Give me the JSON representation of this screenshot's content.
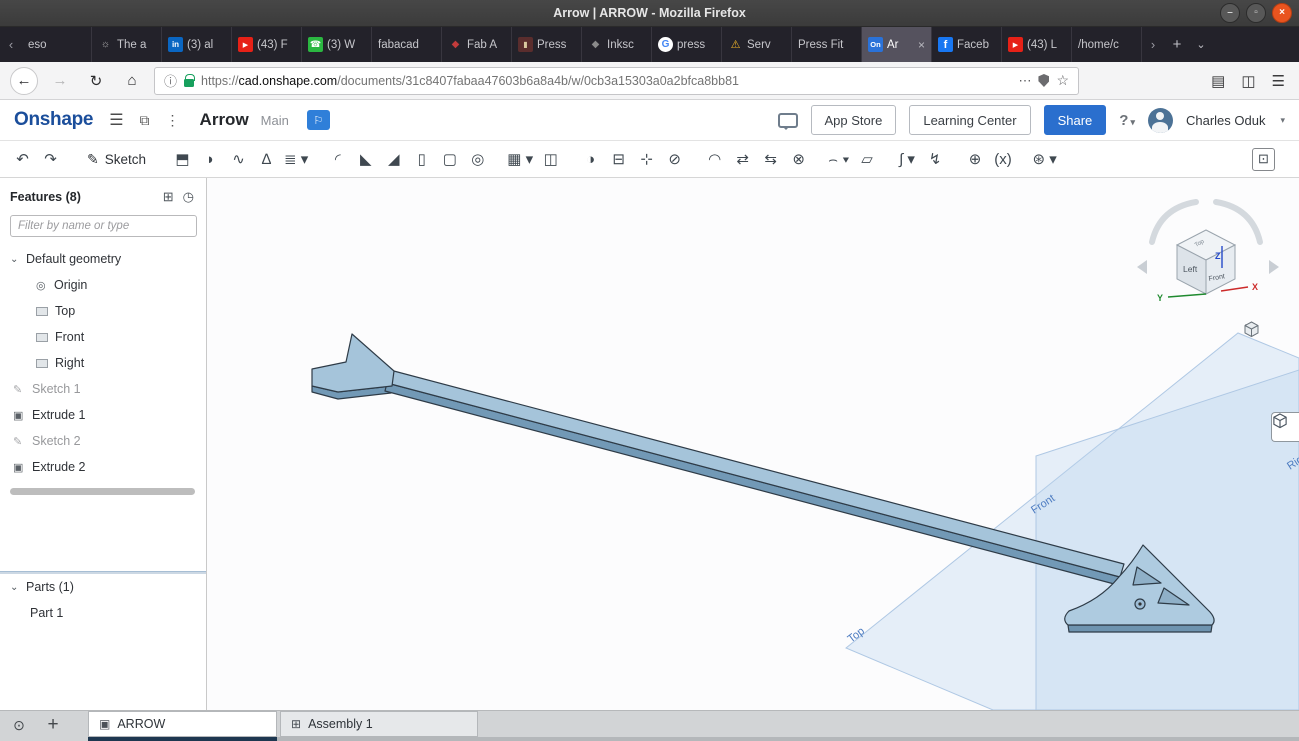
{
  "window": {
    "title": "Arrow | ARROW - Mozilla Firefox",
    "minimize": "–",
    "maximize": "▫",
    "close": "×"
  },
  "tabstrip": {
    "scroll_left": "‹",
    "scroll_right": "›",
    "new_tab": "+",
    "list_tabs": "⌄",
    "close_tab": "×",
    "tabs": [
      {
        "title": "eso",
        "fav": ""
      },
      {
        "title": "The a",
        "fav": "☼"
      },
      {
        "title": "(3) al",
        "fav": "in"
      },
      {
        "title": "(43) F",
        "fav": "▶"
      },
      {
        "title": "(3) W",
        "fav": "☎"
      },
      {
        "title": "fabacad",
        "fav": ""
      },
      {
        "title": "Fab A",
        "fav": "◆"
      },
      {
        "title": "Press",
        "fav": "▮"
      },
      {
        "title": "Inksc",
        "fav": "◆"
      },
      {
        "title": "press",
        "fav": "G"
      },
      {
        "title": "Serv",
        "fav": "⚠"
      },
      {
        "title": "Press Fit",
        "fav": ""
      },
      {
        "title": "Ar",
        "fav": "On"
      },
      {
        "title": "Faceb",
        "fav": "f"
      },
      {
        "title": "(43) L",
        "fav": "▶"
      },
      {
        "title": "/home/c",
        "fav": ""
      }
    ]
  },
  "nav": {
    "back": "←",
    "forward": "→",
    "reload": "↻",
    "home": "⌂",
    "info": "ⓘ",
    "url_scheme": "https://",
    "url_host": "cad.onshape.com",
    "url_path": "/documents/31c8407fabaa47603b6a8a4b/w/0cb3a15303a0a2bfca8bb81",
    "page_actions": "⋯",
    "bookmark": "☆",
    "library": "▤",
    "sidebar": "◫",
    "menu": "☰"
  },
  "osheader": {
    "logo": "Onshape",
    "menu": "☰",
    "versions": "⧉",
    "history": "⋮",
    "title": "Arrow",
    "workspace": "Main",
    "flag": "⚐",
    "app_store": "App Store",
    "learning_center": "Learning Center",
    "share": "Share",
    "help": "?",
    "caret": "▾",
    "user": "Charles Oduk",
    "accent_blue": "#2a6fce"
  },
  "toolbar": {
    "undo": "↶",
    "redo": "↷",
    "sketch_icon": "✎",
    "sketch": "Sketch",
    "icons": [
      "⬒",
      "◗",
      "∿",
      "∆",
      "≣ ▾",
      "◜",
      "◣",
      "◢",
      "▯",
      "▢",
      "◎",
      "▦ ▾",
      "◫",
      "◑",
      "⊟",
      "⊹",
      "⊘",
      "◠",
      "⇄",
      "⇆",
      "⊗",
      "⌢ ▾",
      "▱",
      "∫ ▾",
      "↯",
      "⊕",
      "(x)",
      "⊛ ▾",
      "⊡"
    ]
  },
  "features": {
    "title": "Features (8)",
    "folder_icon": "⊞",
    "clock_icon": "◷",
    "filter_placeholder": "Filter by name or type",
    "chevron": "⌄",
    "origin_icon": "◎",
    "sketch_icon": "✎",
    "extrude_icon": "▣",
    "sections": {
      "default_geometry": "Default geometry",
      "parts": "Parts (1)"
    },
    "geometry_items": [
      "Origin",
      "Top",
      "Front",
      "Right"
    ],
    "feature_items": [
      "Sketch 1",
      "Extrude 1",
      "Sketch 2",
      "Extrude 2"
    ],
    "part_items": [
      "Part 1"
    ]
  },
  "viewport": {
    "plane_top": "Top",
    "plane_front": "Front",
    "plane_right": "Right",
    "cube_top": "Top",
    "cube_left": "Left",
    "cube_front": "Front",
    "axis_x": "X",
    "axis_y": "Y",
    "axis_z": "Z",
    "display_caret": "▾",
    "model_color": "#a5c4da",
    "model_side_color": "#7299b6",
    "plane_color": "#b9d3ee"
  },
  "bottombar": {
    "manager_icon": "⊙",
    "add_icon": "+",
    "partstudio_icon": "▣",
    "assembly_icon": "⊞",
    "tabs": [
      "ARROW",
      "Assembly 1"
    ]
  }
}
